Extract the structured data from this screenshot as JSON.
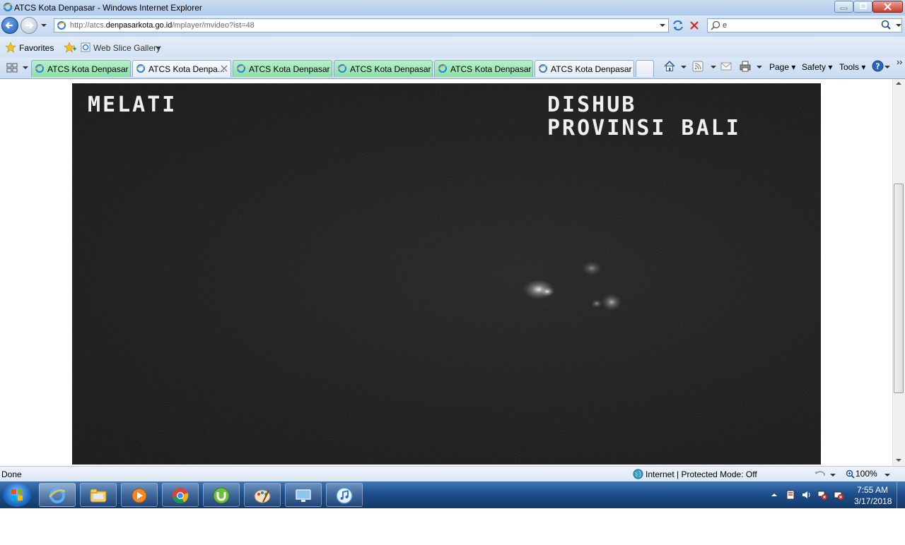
{
  "window": {
    "title": "ATCS Kota Denpasar - Windows Internet Explorer"
  },
  "address": {
    "prefix": "http://atcs.",
    "domain": "denpasarkota.go.id",
    "path": "/mplayer/mvideo?ist=48"
  },
  "search": {
    "value": "e"
  },
  "favorites_bar": {
    "favorites_label": "Favorites",
    "web_slice_label": "Web Slice Gallery"
  },
  "tabs": [
    {
      "label": "ATCS Kota Denpasar",
      "state": "green"
    },
    {
      "label": "ATCS Kota Denpa...",
      "state": "active"
    },
    {
      "label": "ATCS Kota Denpasar",
      "state": "green"
    },
    {
      "label": "ATCS Kota Denpasar",
      "state": "green"
    },
    {
      "label": "ATCS Kota Denpasar",
      "state": "green"
    },
    {
      "label": "ATCS Kota Denpasar",
      "state": "white"
    }
  ],
  "command_bar": {
    "page": "Page",
    "safety": "Safety",
    "tools": "Tools"
  },
  "camera": {
    "location": "MELATI",
    "operator_line1": "DISHUB",
    "operator_line2": "PROVINSI BALI"
  },
  "status_bar": {
    "status": "Done",
    "zone": "Internet | Protected Mode: Off",
    "zoom": "100%"
  },
  "taskbar": {
    "apps": [
      "internet-explorer",
      "file-explorer",
      "media-player",
      "chrome",
      "utorrent",
      "paint",
      "remote-desktop",
      "itunes"
    ],
    "time": "7:55 AM",
    "date": "3/17/2018"
  },
  "colors": {
    "tab_green": "#8fdeaa",
    "ie_blue": "#1f6cc4",
    "camera_bg": "#151515",
    "close_red": "#c7402e"
  }
}
